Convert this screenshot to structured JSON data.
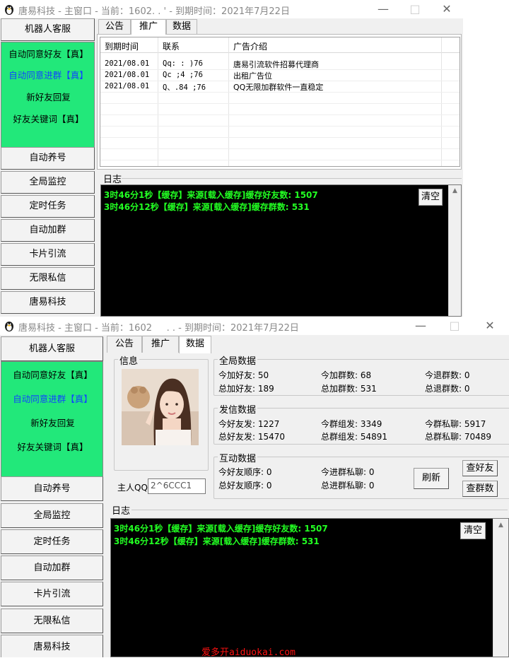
{
  "window_title": "唐易科技 - 主窗口 - 当前: 1602... - 到期时间: 2021年7月22日",
  "window_title_top": "唐易科技 - 主窗口 - 当前：1602.    .  ' - 到期时间：2021年7月22日",
  "window_title_bottom": "唐易科技 - 主窗口 - 当前：1602     . . - 到期时间：2021年7月22日",
  "controls": {
    "minimize": "—",
    "maximize": "□",
    "close": "✕"
  },
  "sidebar": {
    "top_button": "机器人客服",
    "green_items": [
      {
        "label": "自动同意好友【真】",
        "color": "#000000"
      },
      {
        "label": "自动同意进群【真】",
        "color": "#1144ff"
      },
      {
        "label": "新好友回复",
        "color": "#000000"
      },
      {
        "label": "好友关键词【真】",
        "color": "#000000"
      }
    ],
    "buttons": [
      "自动养号",
      "全局监控",
      "定时任务",
      "自动加群",
      "卡片引流",
      "无限私信",
      "唐易科技"
    ]
  },
  "tabs": [
    "公告",
    "推广",
    "数据"
  ],
  "promo_table": {
    "columns": [
      "到期时间",
      "联系",
      "广告介绍"
    ],
    "rows": [
      [
        "2021/08.01",
        "Qq:   : )76",
        "唐易引流软件招募代理商"
      ],
      [
        "2021/08.01",
        "Qc  ;4  ;76",
        "出租广告位"
      ],
      [
        "2021/08.01",
        "Q、.84  ;76",
        "QQ无限加群软件一直稳定"
      ]
    ]
  },
  "log": {
    "label": "日志",
    "clear_button": "清空",
    "lines": [
      "3时46分1秒【缓存】来源[载入缓存]缓存好友数: 1507",
      "3时46分12秒【缓存】来源[载入缓存]缓存群数: 531"
    ]
  },
  "info": {
    "label": "信息",
    "owner_label": "主人QQ",
    "owner_value": "2^6CCC1"
  },
  "stats": {
    "global": {
      "title": "全局数据",
      "fields": [
        [
          "今加好友: 50",
          "今加群数: 68",
          "今退群数: 0"
        ],
        [
          "总加好友: 189",
          "总加群数: 531",
          "总退群数: 0"
        ]
      ]
    },
    "send": {
      "title": "发信数据",
      "fields": [
        [
          "今好友发: 1227",
          "今群组发: 3349",
          "今群私聊: 5917"
        ],
        [
          "总好友发: 15470",
          "总群组发: 54891",
          "总群私聊: 70489"
        ]
      ]
    },
    "interact": {
      "title": "互动数据",
      "fields": [
        [
          "今好友顺序: 0",
          "今进群私聊: 0"
        ],
        [
          "总好友顺序: 0",
          "总进群私聊: 0"
        ]
      ],
      "refresh_button": "刷新",
      "check_friends_button": "查好友",
      "check_groups_button": "查群数"
    }
  },
  "watermark": "爱多开aiduokai.com",
  "colors": {
    "sidebar_green": "#22e87a",
    "log_text": "#22ff22",
    "watermark": "#ff1111",
    "link_blue": "#1144ff"
  }
}
